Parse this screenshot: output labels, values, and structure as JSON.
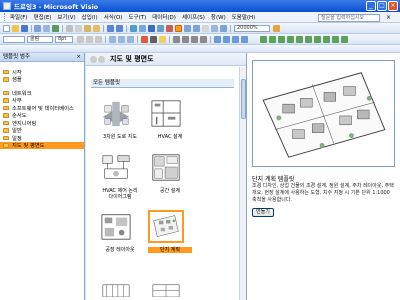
{
  "window": {
    "title": "드로잉3 - Microsoft Visio"
  },
  "menubar": {
    "items": [
      "파일(F)",
      "편집(E)",
      "보기(V)",
      "삽입(I)",
      "서식(O)",
      "도구(T)",
      "데이터(D)",
      "셰이프(S)",
      "창(W)",
      "도움말(H)"
    ],
    "help_search_placeholder": "질문을 입력하십시오"
  },
  "toolbar": {
    "zoom_value": "20000%",
    "font_name": "굴림",
    "font_size": "8pt"
  },
  "left_pane": {
    "header": "템플릿 범주",
    "top_items": [
      "시작",
      "샘플"
    ],
    "categories": [
      "네트워크",
      "사무",
      "소프트웨어 및 데이터베이스",
      "순서도",
      "엔지니어링",
      "일반",
      "일정",
      "지도 및 평면도"
    ],
    "selected_index": 7
  },
  "center_pane": {
    "title": "지도 및 평면도",
    "section": "모든 템플릿",
    "tiles": [
      {
        "label": "3차원 도로 지도"
      },
      {
        "label": "HVAC 설계"
      },
      {
        "label": "HVAC 제어 논리\n다이어그램"
      },
      {
        "label": "공간 설계"
      },
      {
        "label": "공장 레이아웃"
      },
      {
        "label": "단지 계획"
      }
    ],
    "selected_tile": 5
  },
  "right_pane": {
    "title": "단지 계획 템플릿",
    "description": "조경 디자인, 상업 건물의 조경 설계, 정원 설계, 주차 레이아웃, 주택 개요, 현장 설계에 사용하는 도형, 치수 지정 시 기본 단위 1:1000 축척을 사용합니다.",
    "create_label": "만들기"
  },
  "colors": {
    "selection": "#ff9a1f",
    "titlebar": "#0a4fd0"
  }
}
